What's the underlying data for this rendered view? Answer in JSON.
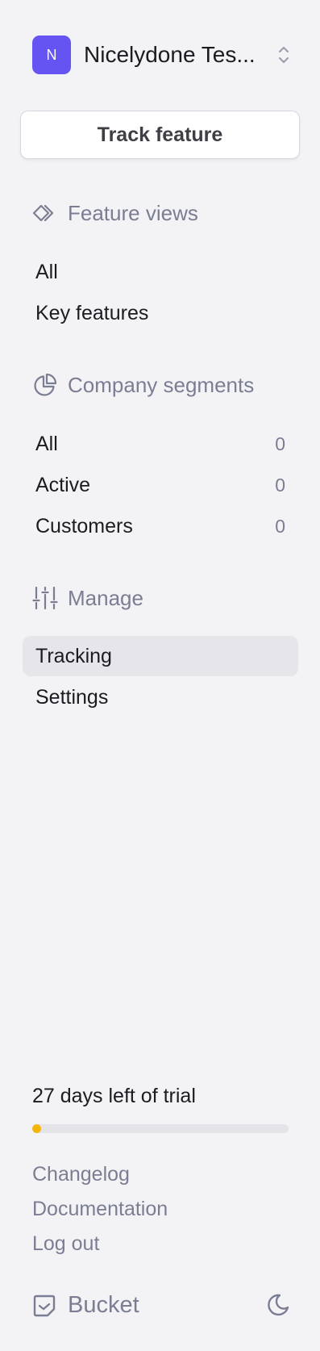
{
  "org": {
    "initial": "N",
    "name": "Nicelydone Tes..."
  },
  "track_feature_label": "Track feature",
  "feature_views": {
    "header": "Feature views",
    "items": [
      {
        "label": "All"
      },
      {
        "label": "Key features"
      }
    ]
  },
  "company_segments": {
    "header": "Company segments",
    "items": [
      {
        "label": "All",
        "count": "0"
      },
      {
        "label": "Active",
        "count": "0"
      },
      {
        "label": "Customers",
        "count": "0"
      }
    ]
  },
  "manage": {
    "header": "Manage",
    "items": [
      {
        "label": "Tracking",
        "active": true
      },
      {
        "label": "Settings",
        "active": false
      }
    ]
  },
  "trial": {
    "text": "27 days left of trial",
    "progress_fraction": 0.035
  },
  "footer_links": [
    {
      "label": "Changelog"
    },
    {
      "label": "Documentation"
    },
    {
      "label": "Log out"
    }
  ],
  "brand": {
    "name": "Bucket"
  },
  "icons": {
    "feature_views": "diamonds-icon",
    "company_segments": "pie-chart-icon",
    "manage": "sliders-icon",
    "org_switch": "chevron-up-down-icon",
    "brand": "bucket-logo-icon",
    "theme": "moon-icon"
  },
  "colors": {
    "accent": "#6554f2",
    "background": "#f3f3f6",
    "muted_text": "#7b7d93",
    "active_item": "#e6e6ea",
    "trial_progress": "#f5b40a"
  }
}
